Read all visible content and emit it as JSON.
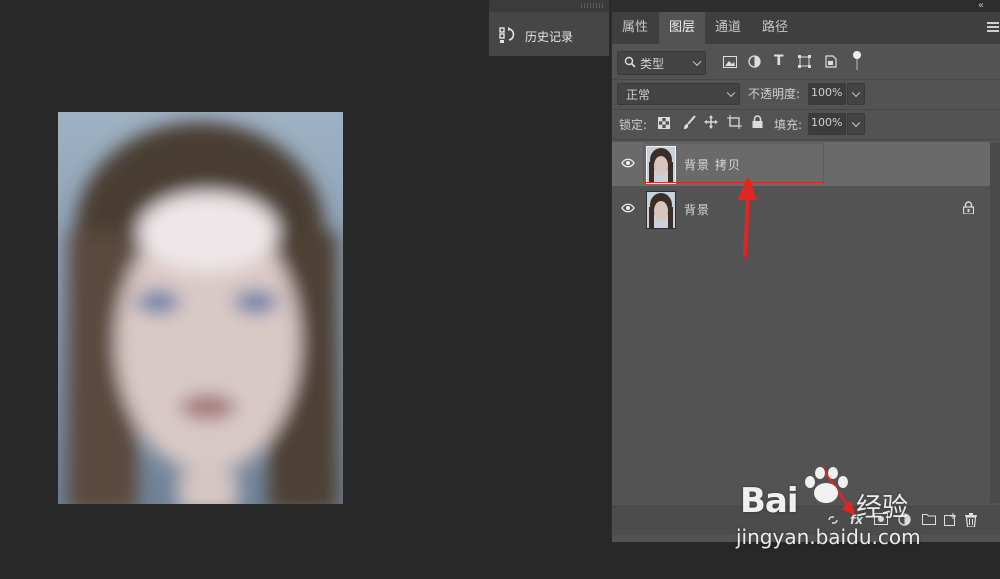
{
  "history_panel": {
    "label": "历史记录",
    "icon": "history-icon"
  },
  "tabs": [
    {
      "label": "属性",
      "active": false
    },
    {
      "label": "图层",
      "active": true
    },
    {
      "label": "通道",
      "active": false
    },
    {
      "label": "路径",
      "active": false
    }
  ],
  "filter": {
    "kind_label": "类型"
  },
  "blend": {
    "mode": "正常",
    "opacity_label": "不透明度:",
    "opacity_value": "100%"
  },
  "lock": {
    "label": "锁定:",
    "fill_label": "填充:",
    "fill_value": "100%"
  },
  "layers": [
    {
      "name": "背景 拷贝",
      "visible": true,
      "selected": true,
      "locked": false
    },
    {
      "name": "背景",
      "visible": true,
      "selected": false,
      "locked": true
    }
  ],
  "watermark": {
    "brand": "Bai",
    "brand_cn": "经验",
    "url": "jingyan.baidu.com"
  },
  "colors": {
    "panel": "#535353",
    "selected_row": "#6a6a6a",
    "annotation_red": "#e02525"
  }
}
